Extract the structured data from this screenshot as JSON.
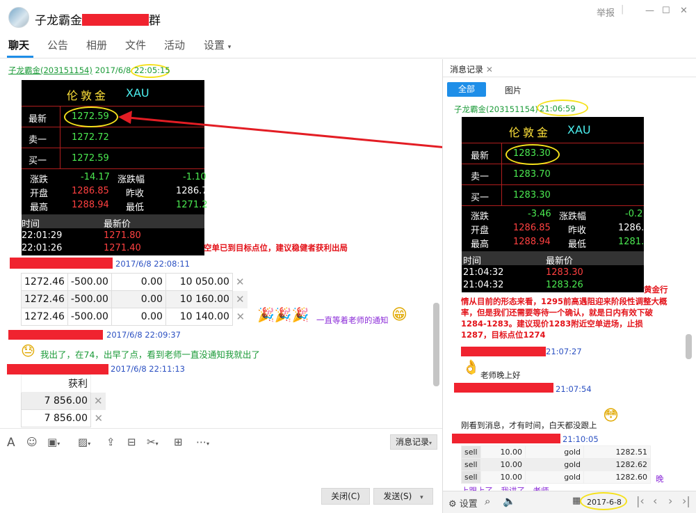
{
  "window": {
    "title_prefix": "子龙霸金",
    "title_suffix": "群",
    "report": "举报",
    "minimize": "—",
    "maximize": "☐",
    "close": "✕"
  },
  "tabs": [
    "聊天",
    "公告",
    "相册",
    "文件",
    "活动",
    "设置"
  ],
  "chat": {
    "msg1": {
      "sender": "子龙霸金(203151154)",
      "date": "2017/6/8",
      "time": "22:05:15"
    },
    "quote1": {
      "name": "伦敦金",
      "code": "XAU",
      "latest_label": "最新",
      "latest": "1272.59",
      "sell_label": "卖一",
      "sell": "1272.72",
      "buy_label": "买一",
      "buy": "1272.59",
      "chg_label": "涨跌",
      "chg": "-14.17",
      "chgpct_label": "涨跌幅",
      "chgpct": "-1.10",
      "open_label": "开盘",
      "open": "1286.85",
      "prev_label": "昨收",
      "prev": "1286.7",
      "high_label": "最高",
      "high": "1288.94",
      "low_label": "最低",
      "low": "1271.2",
      "time_label": "时间",
      "price_label": "最新价",
      "ticks": [
        {
          "t": "22:01:29",
          "p": "1271.80"
        },
        {
          "t": "22:01:26",
          "p": "1271.40"
        }
      ]
    },
    "note1": "空单已到目标点位，建议稳健者获利出局",
    "msg2": {
      "time": "2017/6/8 22:08:11"
    },
    "table1": [
      [
        "1272.46",
        "-500.00",
        "0.00",
        "10 050.00"
      ],
      [
        "1272.46",
        "-500.00",
        "0.00",
        "10 160.00"
      ],
      [
        "1272.46",
        "-500.00",
        "0.00",
        "10 140.00"
      ]
    ],
    "msg2_text": "一直等着老师的通知",
    "msg3": {
      "time": "2017/6/8 22:09:37"
    },
    "msg3_text": "我出了，在74，出早了点，看到老师一直没通知我就出了",
    "msg4": {
      "time": "2017/6/8 22:11:13"
    },
    "table2_header": "获利",
    "table2": [
      "7 856.00",
      "7 856.00"
    ]
  },
  "toolbar": {
    "history": "消息记录",
    "close": "关闭(C)",
    "send": "发送(S)"
  },
  "right": {
    "tab": "消息记录",
    "filter_all": "全部",
    "filter_img": "图片",
    "msg1": {
      "sender": "子龙霸金(203151154)",
      "time": "21:06:59"
    },
    "quote2": {
      "name": "伦敦金",
      "code": "XAU",
      "latest_label": "最新",
      "latest": "1283.30",
      "sell_label": "卖一",
      "sell": "1283.70",
      "buy_label": "买一",
      "buy": "1283.30",
      "chg_label": "涨跌",
      "chg": "-3.46",
      "chgpct_label": "涨跌幅",
      "chgpct": "-0.2",
      "open_label": "开盘",
      "open": "1286.85",
      "prev_label": "昨收",
      "prev": "1286.",
      "high_label": "最高",
      "high": "1288.94",
      "low_label": "最低",
      "low": "1281.",
      "time_label": "时间",
      "price_label": "最新价",
      "ticks": [
        {
          "t": "21:04:32",
          "p": "1283.30"
        },
        {
          "t": "21:04:32",
          "p": "1283.26"
        }
      ]
    },
    "analysis_tail": "黄金行",
    "analysis": "情从目前的形态来看，1295前高遇阻迎来阶段性调整大概率，但是我们还需要等待一个确认，就是日内有效下破1284-1283。建议现价1283附近空单进场，止损1287，目标点位1274",
    "msg2_time": "21:07:27",
    "msg2_text": "老师晚上好",
    "msg3_time": "21:07:54",
    "msg3_text": "刚看到消息，才有时间，白天都没跟上",
    "msg4_time": "21:10:05",
    "trades": [
      [
        "sell",
        "10.00",
        "gold",
        "1282.51"
      ],
      [
        "sell",
        "10.00",
        "gold",
        "1282.62"
      ],
      [
        "sell",
        "10.00",
        "gold",
        "1282.60"
      ]
    ],
    "msg4_tail": "晚",
    "msg4_text": "上跟上了，我讲了，老师",
    "settings": "设置",
    "date": "2017-6-8"
  }
}
